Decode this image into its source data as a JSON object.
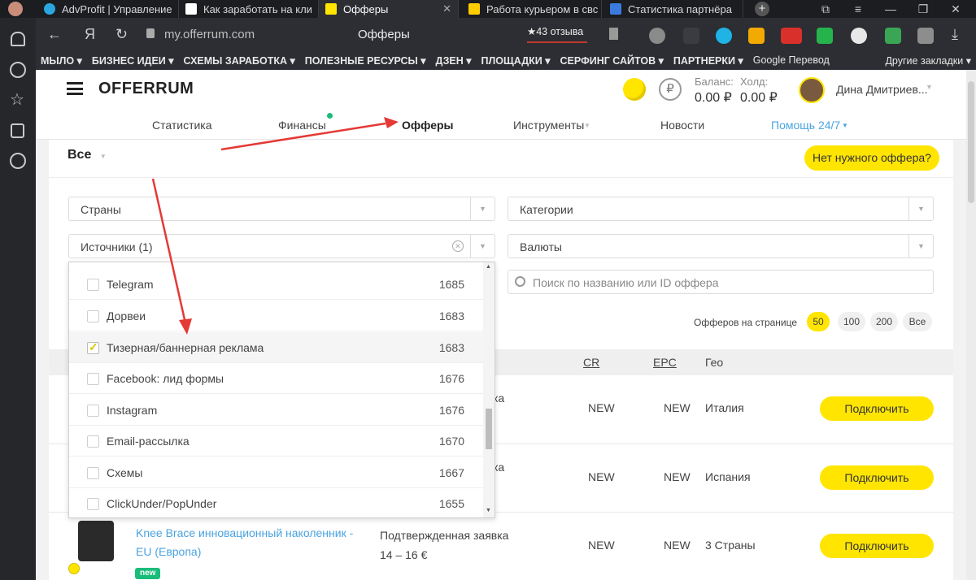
{
  "browser": {
    "tabs": [
      {
        "title": "AdvProfit | Управление",
        "fav": "#2aa7e0"
      },
      {
        "title": "Как заработать на кли",
        "fav": "#ffffff"
      },
      {
        "title": "Офферы",
        "fav": "#ffe500"
      },
      {
        "title": "Работа курьером в свс",
        "fav": "#ffcc00"
      },
      {
        "title": "Статистика партнёра",
        "fav": "#3b7be0"
      }
    ],
    "url": "my.offerrum.com",
    "page_title": "Офферы",
    "reviews_badge": "★43 отзыва",
    "bookmarks": [
      "МЫЛО ▾",
      "БИЗНЕС ИДЕИ ▾",
      "СХЕМЫ ЗАРАБОТКА ▾",
      "ПОЛЕЗНЫЕ РЕСУРСЫ ▾",
      "ДЗЕН ▾",
      "ПЛОЩАДКИ ▾",
      "СЕРФИНГ САЙТОВ ▾",
      "ПАРТНЕРКИ ▾",
      "Google Перевод"
    ],
    "other_bookmarks": "Другие закладки ▾"
  },
  "site": {
    "logo": "OFFERRUM",
    "balance_label": "Баланс:",
    "balance_value": "0.00 ₽",
    "hold_label": "Холд:",
    "hold_value": "0.00 ₽",
    "user_name": "Дина Дмитриев..."
  },
  "nav": {
    "statistics": "Статистика",
    "finances": "Финансы",
    "offers": "Офферы",
    "tools": "Инструменты",
    "news": "Новости",
    "help": "Помощь 24/7"
  },
  "filters": {
    "all": "Все",
    "no_offer_button": "Нет нужного оффера?",
    "countries": "Страны",
    "categories": "Категории",
    "sources": "Источники (1)",
    "currencies": "Валюты",
    "search_placeholder": "Поиск по названию или ID оффера",
    "per_page_label": "Офферов на странице",
    "per_page_options": [
      "50",
      "100",
      "200",
      "Все"
    ]
  },
  "sources_dropdown": [
    {
      "label": "Telegram",
      "count": "1685",
      "checked": false
    },
    {
      "label": "Дорвеи",
      "count": "1683",
      "checked": false
    },
    {
      "label": "Тизерная/баннерная реклама",
      "count": "1683",
      "checked": true
    },
    {
      "label": "Facebook: лид формы",
      "count": "1676",
      "checked": false
    },
    {
      "label": "Instagram",
      "count": "1676",
      "checked": false
    },
    {
      "label": "Email-рассылка",
      "count": "1670",
      "checked": false
    },
    {
      "label": "Схемы",
      "count": "1667",
      "checked": false
    },
    {
      "label": "ClickUnder/PopUnder",
      "count": "1655",
      "checked": false
    }
  ],
  "table": {
    "col_cr": "CR",
    "col_epc": "EPC",
    "col_geo": "Гео",
    "rows": [
      {
        "partial": "ка",
        "cr": "NEW",
        "epc": "NEW",
        "geo": "Италия",
        "action": "Подключить"
      },
      {
        "partial": "ка",
        "cr": "NEW",
        "epc": "NEW",
        "geo": "Испания",
        "action": "Подключить"
      },
      {
        "name": "Knee Brace инновационный наколенник - EU (Европа)",
        "badge": "new",
        "goal": "Подтвержденная заявка",
        "payout": "14 – 16 €",
        "cr": "NEW",
        "epc": "NEW",
        "geo": "3 Страны",
        "action": "Подключить"
      }
    ]
  }
}
